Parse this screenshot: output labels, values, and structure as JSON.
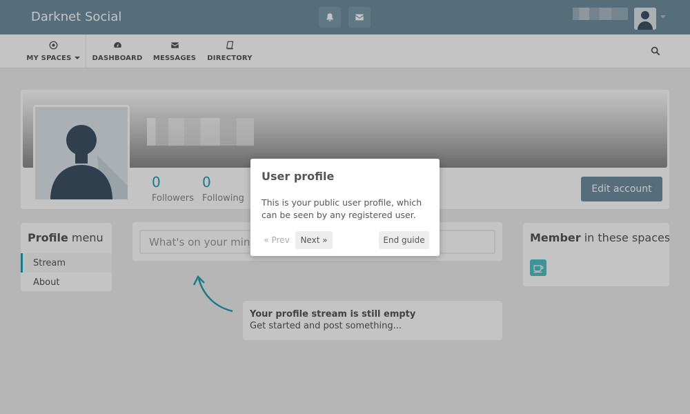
{
  "app": {
    "brand": "Darknet Social"
  },
  "nav": {
    "my_spaces": "MY SPACES",
    "dashboard": "DASHBOARD",
    "messages": "MESSAGES",
    "directory": "DIRECTORY"
  },
  "profile": {
    "followers_count": "0",
    "followers_label": "Followers",
    "following_count": "0",
    "following_label": "Following",
    "edit_button": "Edit account"
  },
  "profile_menu": {
    "title_bold": "Profile",
    "title_rest": " menu",
    "items": [
      {
        "label": "Stream",
        "active": true
      },
      {
        "label": "About",
        "active": false
      }
    ]
  },
  "post": {
    "placeholder": "What's on your mind?"
  },
  "empty_stream": {
    "title": "Your profile stream is still empty",
    "subtitle": "Get started and post something..."
  },
  "spaces": {
    "title_bold": "Member",
    "title_rest": " in these spaces"
  },
  "tour": {
    "title": "User profile",
    "body": "This is your public user profile, which can be seen by any registered user.",
    "prev": "« Prev",
    "next": "Next »",
    "end": "End guide"
  },
  "colors": {
    "topbar": "#708fa0",
    "accent": "#21a1b3",
    "space_icon": "#4cc1c9"
  }
}
